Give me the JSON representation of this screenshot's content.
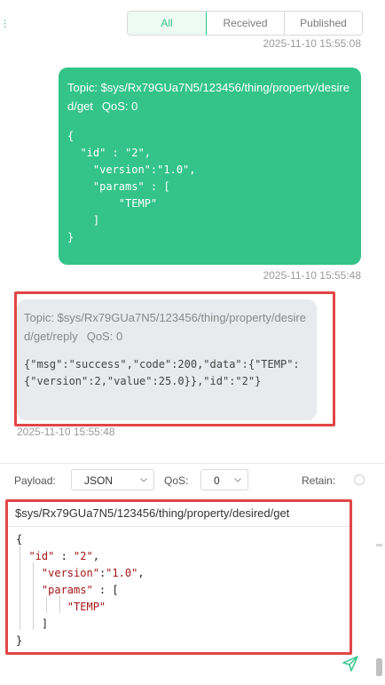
{
  "filter_tabs": {
    "all": "All",
    "received": "Received",
    "published": "Published",
    "active": "All"
  },
  "messages": [
    {
      "direction": "published",
      "topic": "Topic: $sys/Rx79GUa7N5/123456/thing/property/desired/get",
      "qos": "QoS: 0",
      "payload_lines": [
        "{",
        "  \"id\" : \"2\",",
        "    \"version\":\"1.0\",",
        "    \"params\" : [",
        "        \"TEMP\"",
        "    ]",
        "}"
      ],
      "timestamp": "2025-11-10 15:55:48"
    },
    {
      "direction": "received",
      "topic": "Topic: $sys/Rx79GUa7N5/123456/thing/property/desired/get/reply",
      "qos": "QoS: 0",
      "payload": "{\"msg\":\"success\",\"code\":200,\"data\":{\"TEMP\":{\"version\":2,\"value\":25.0}},\"id\":\"2\"}",
      "timestamp": "2025-11-10 15:55:48"
    }
  ],
  "top_timestamp_partial": "2025-11-10 15:55:08",
  "composer": {
    "payload_label": "Payload:",
    "payload_format": "JSON",
    "qos_label": "QoS:",
    "qos_value": "0",
    "retain_label": "Retain:",
    "retain_checked": false,
    "topic": "$sys/Rx79GUa7N5/123456/thing/property/desired/get",
    "send_icon": "send-icon"
  },
  "colors": {
    "accent": "#34c48a",
    "highlight_border": "#e24646",
    "received_bubble": "#e9eaed"
  }
}
